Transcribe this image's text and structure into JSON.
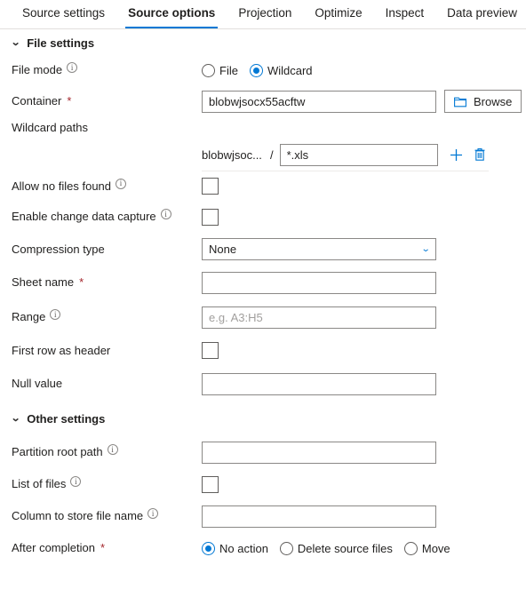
{
  "tabs": [
    {
      "label": "Source settings",
      "active": false
    },
    {
      "label": "Source options",
      "active": true
    },
    {
      "label": "Projection",
      "active": false
    },
    {
      "label": "Optimize",
      "active": false
    },
    {
      "label": "Inspect",
      "active": false
    },
    {
      "label": "Data preview",
      "active": false
    }
  ],
  "accent_color": "#0078d4",
  "required_color": "#a4262c",
  "sections": {
    "file_settings": {
      "title": "File settings",
      "chevron": "chevron-down"
    },
    "other_settings": {
      "title": "Other settings",
      "chevron": "chevron-down"
    }
  },
  "fields": {
    "file_mode": {
      "label": "File mode",
      "info": true,
      "options": [
        "File",
        "Wildcard"
      ],
      "selected": "Wildcard"
    },
    "container": {
      "label": "Container",
      "required": true,
      "value": "blobwjsocx55acftw",
      "placeholder": "",
      "browse_label": "Browse"
    },
    "wildcard_paths": {
      "label": "Wildcard paths",
      "prefix": "blobwjsoc...",
      "separator": "/",
      "value": "*.xls",
      "placeholder": "",
      "add_icon": "plus-icon",
      "delete_icon": "trash-icon"
    },
    "allow_no_files_found": {
      "label": "Allow no files found",
      "info": true,
      "checked": false
    },
    "enable_cdc": {
      "label": "Enable change data capture",
      "info": true,
      "checked": false
    },
    "compression_type": {
      "label": "Compression type",
      "value": "None",
      "options": [
        "None"
      ]
    },
    "sheet_name": {
      "label": "Sheet name",
      "required": true,
      "value": "",
      "placeholder": ""
    },
    "range": {
      "label": "Range",
      "info": true,
      "value": "",
      "placeholder": "e.g. A3:H5"
    },
    "first_row_as_header": {
      "label": "First row as header",
      "checked": false
    },
    "null_value": {
      "label": "Null value",
      "value": "",
      "placeholder": ""
    },
    "partition_root_path": {
      "label": "Partition root path",
      "info": true,
      "value": "",
      "placeholder": ""
    },
    "list_of_files": {
      "label": "List of files",
      "info": true,
      "checked": false
    },
    "column_to_store_file_name": {
      "label": "Column to store file name",
      "info": true,
      "value": "",
      "placeholder": ""
    },
    "after_completion": {
      "label": "After completion",
      "required": true,
      "options": [
        "No action",
        "Delete source files",
        "Move"
      ],
      "selected": "No action"
    }
  }
}
